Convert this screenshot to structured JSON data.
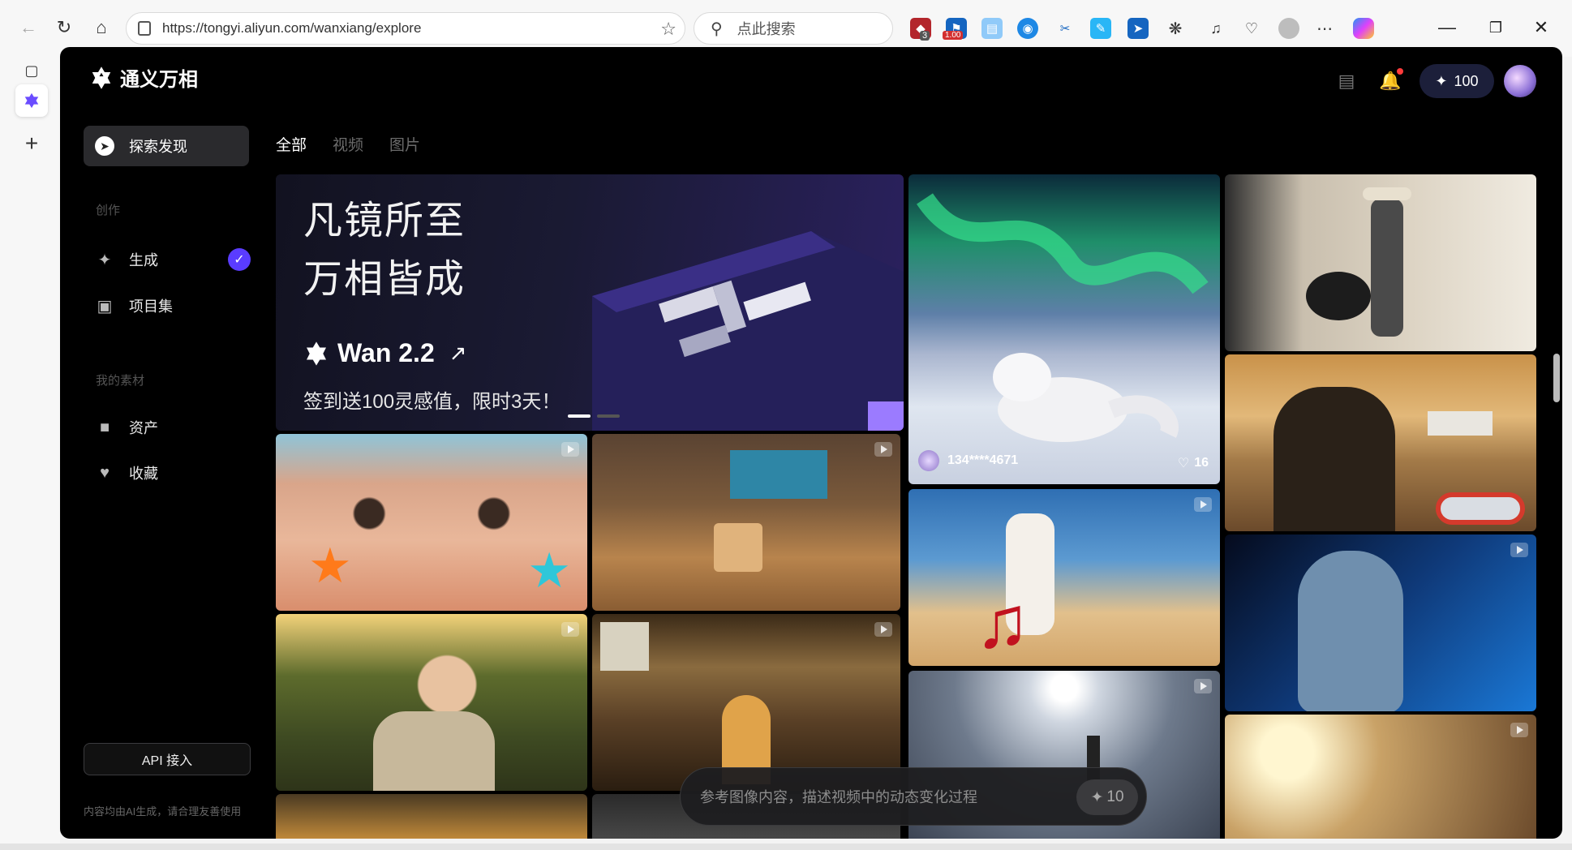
{
  "browser": {
    "url": "https://tongyi.aliyun.com/wanxiang/explore",
    "search_placeholder": "点此搜索",
    "ext_badges": [
      "3",
      "1.00"
    ]
  },
  "app": {
    "name": "通义万相",
    "credits": "100"
  },
  "sidebar": {
    "explore": "探索发现",
    "section_create": "创作",
    "generate": "生成",
    "projects": "项目集",
    "section_materials": "我的素材",
    "assets": "资产",
    "favorites": "收藏",
    "api_button": "API 接入",
    "disclaimer": "内容均由AI生成，请合理友善使用"
  },
  "filter_tabs": [
    "全部",
    "视频",
    "图片"
  ],
  "banner": {
    "line1": "凡镜所至",
    "line2": "万相皆成",
    "product": "Wan 2.2",
    "promo": "签到送100灵感值，限时3天！"
  },
  "featured": {
    "user": "134****4671",
    "likes": "16"
  },
  "prompt": {
    "placeholder": "参考图像内容，描述视频中的动态变化过程",
    "cost": "10"
  },
  "colors": {
    "accent": "#5a3cff",
    "background": "#000000"
  }
}
